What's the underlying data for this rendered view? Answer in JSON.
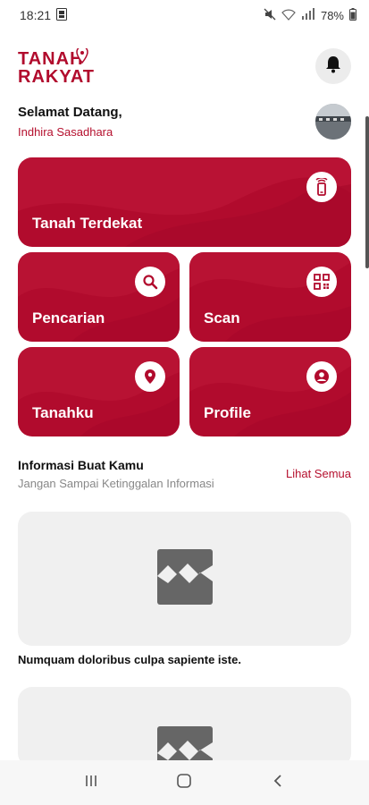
{
  "status_bar": {
    "time": "18:21",
    "battery": "78%"
  },
  "header": {
    "logo_line1": "TANAH",
    "logo_line2": "RAKYAT",
    "notification_icon": "bell-icon"
  },
  "greeting": {
    "title": "Selamat Datang,",
    "name": "Indhira Sasadhara"
  },
  "menu": {
    "nearby": {
      "label": "Tanah Terdekat",
      "icon": "phone-signal-icon"
    },
    "search": {
      "label": "Pencarian",
      "icon": "search-icon"
    },
    "scan": {
      "label": "Scan",
      "icon": "qr-code-icon"
    },
    "myland": {
      "label": "Tanahku",
      "icon": "location-pin-icon"
    },
    "profile": {
      "label": "Profile",
      "icon": "user-icon"
    }
  },
  "info": {
    "title": "Informasi Buat Kamu",
    "subtitle": "Jangan Sampai Ketinggalan Informasi",
    "see_all": "Lihat Semua",
    "items": [
      {
        "title": "Numquam doloribus culpa sapiente iste."
      }
    ]
  },
  "colors": {
    "brand": "#b10b2d",
    "accent_text": "#b5102e"
  }
}
